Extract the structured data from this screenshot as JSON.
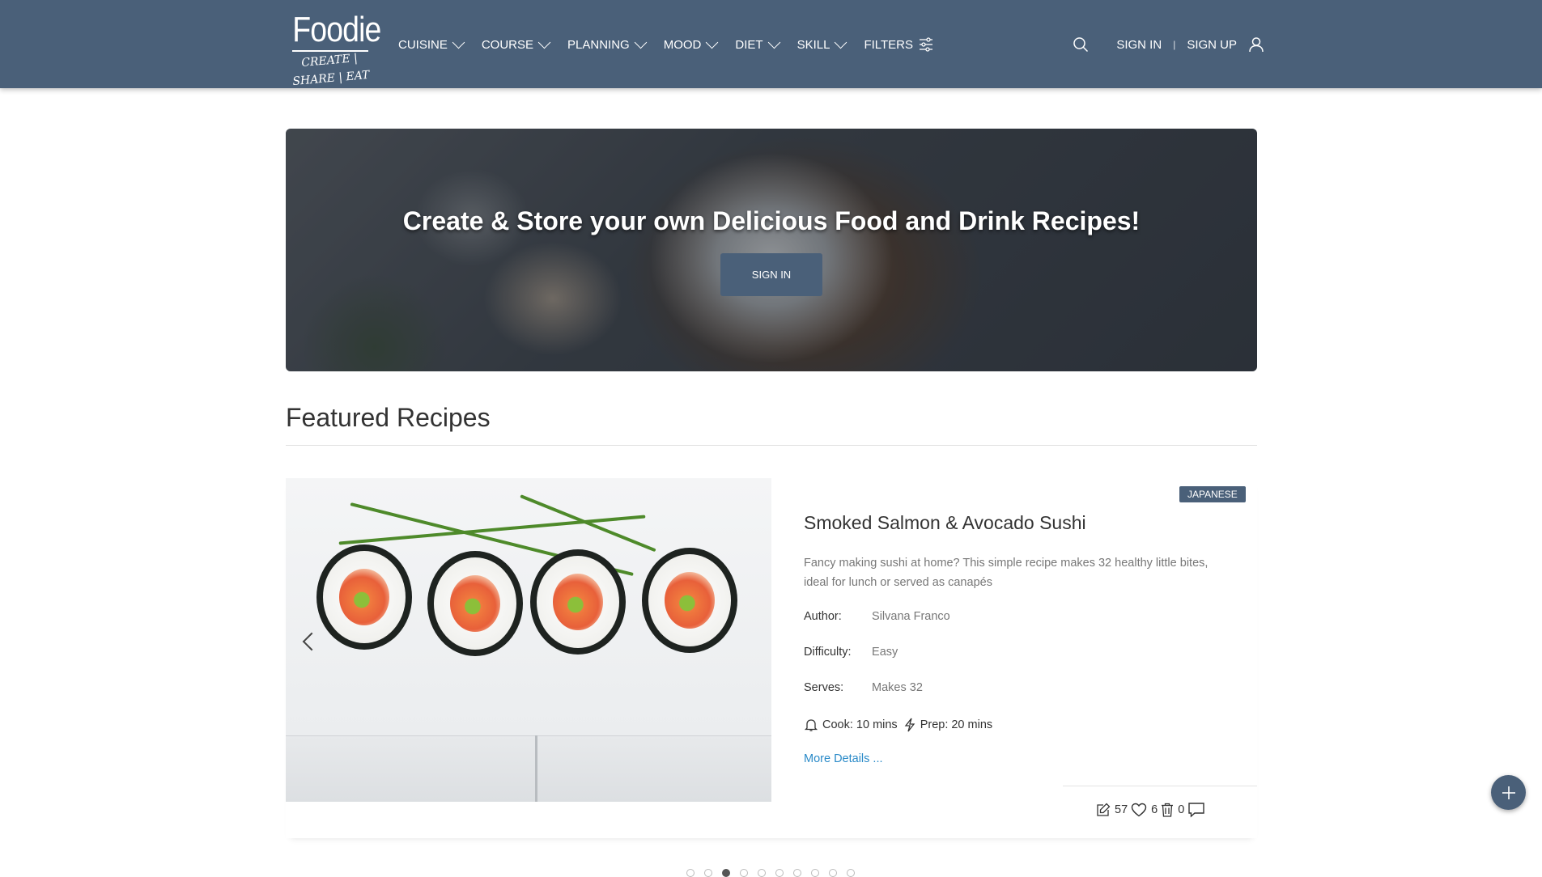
{
  "brand": {
    "name": "Foodie",
    "tagline": "CREATE | SHARE | EAT"
  },
  "nav": {
    "items": [
      {
        "label": "CUISINE"
      },
      {
        "label": "COURSE"
      },
      {
        "label": "PLANNING"
      },
      {
        "label": "MOOD"
      },
      {
        "label": "DIET"
      },
      {
        "label": "SKILL"
      }
    ],
    "filters_label": "FILTERS",
    "sign_in": "SIGN IN",
    "separator": "|",
    "sign_up": "SIGN UP"
  },
  "hero": {
    "title": "Create & Store your own Delicious Food and Drink Recipes!",
    "button_label": "SIGN IN"
  },
  "featured": {
    "title": "Featured Recipes",
    "recipe": {
      "cuisine_tag": "JAPANESE",
      "title": "Smoked Salmon & Avocado Sushi",
      "description": "Fancy making sushi at home? This simple recipe makes 32 healthy little bites, ideal for lunch or served as canapés",
      "author_label": "Author:",
      "author": "Silvana Franco",
      "difficulty_label": "Difficulty:",
      "difficulty": "Easy",
      "serves_label": "Serves:",
      "serves": "Makes 32",
      "cook_time": "Cook: 10 mins",
      "prep_time": "Prep: 20 mins",
      "more_link": "More Details ...",
      "likes": "57",
      "saves": "6",
      "comments": "0"
    },
    "carousel": {
      "total": 10,
      "active_index": 2
    }
  },
  "colors": {
    "primary": "#4a6079",
    "link": "#2a8ac8",
    "muted_text": "#777777"
  },
  "icons": [
    "search-icon",
    "user-icon",
    "filters-icon",
    "chevron-down-icon",
    "chevron-left-icon",
    "bell-icon",
    "bolt-icon",
    "edit-icon",
    "heart-icon",
    "trash-icon",
    "comment-icon",
    "plus-icon"
  ]
}
